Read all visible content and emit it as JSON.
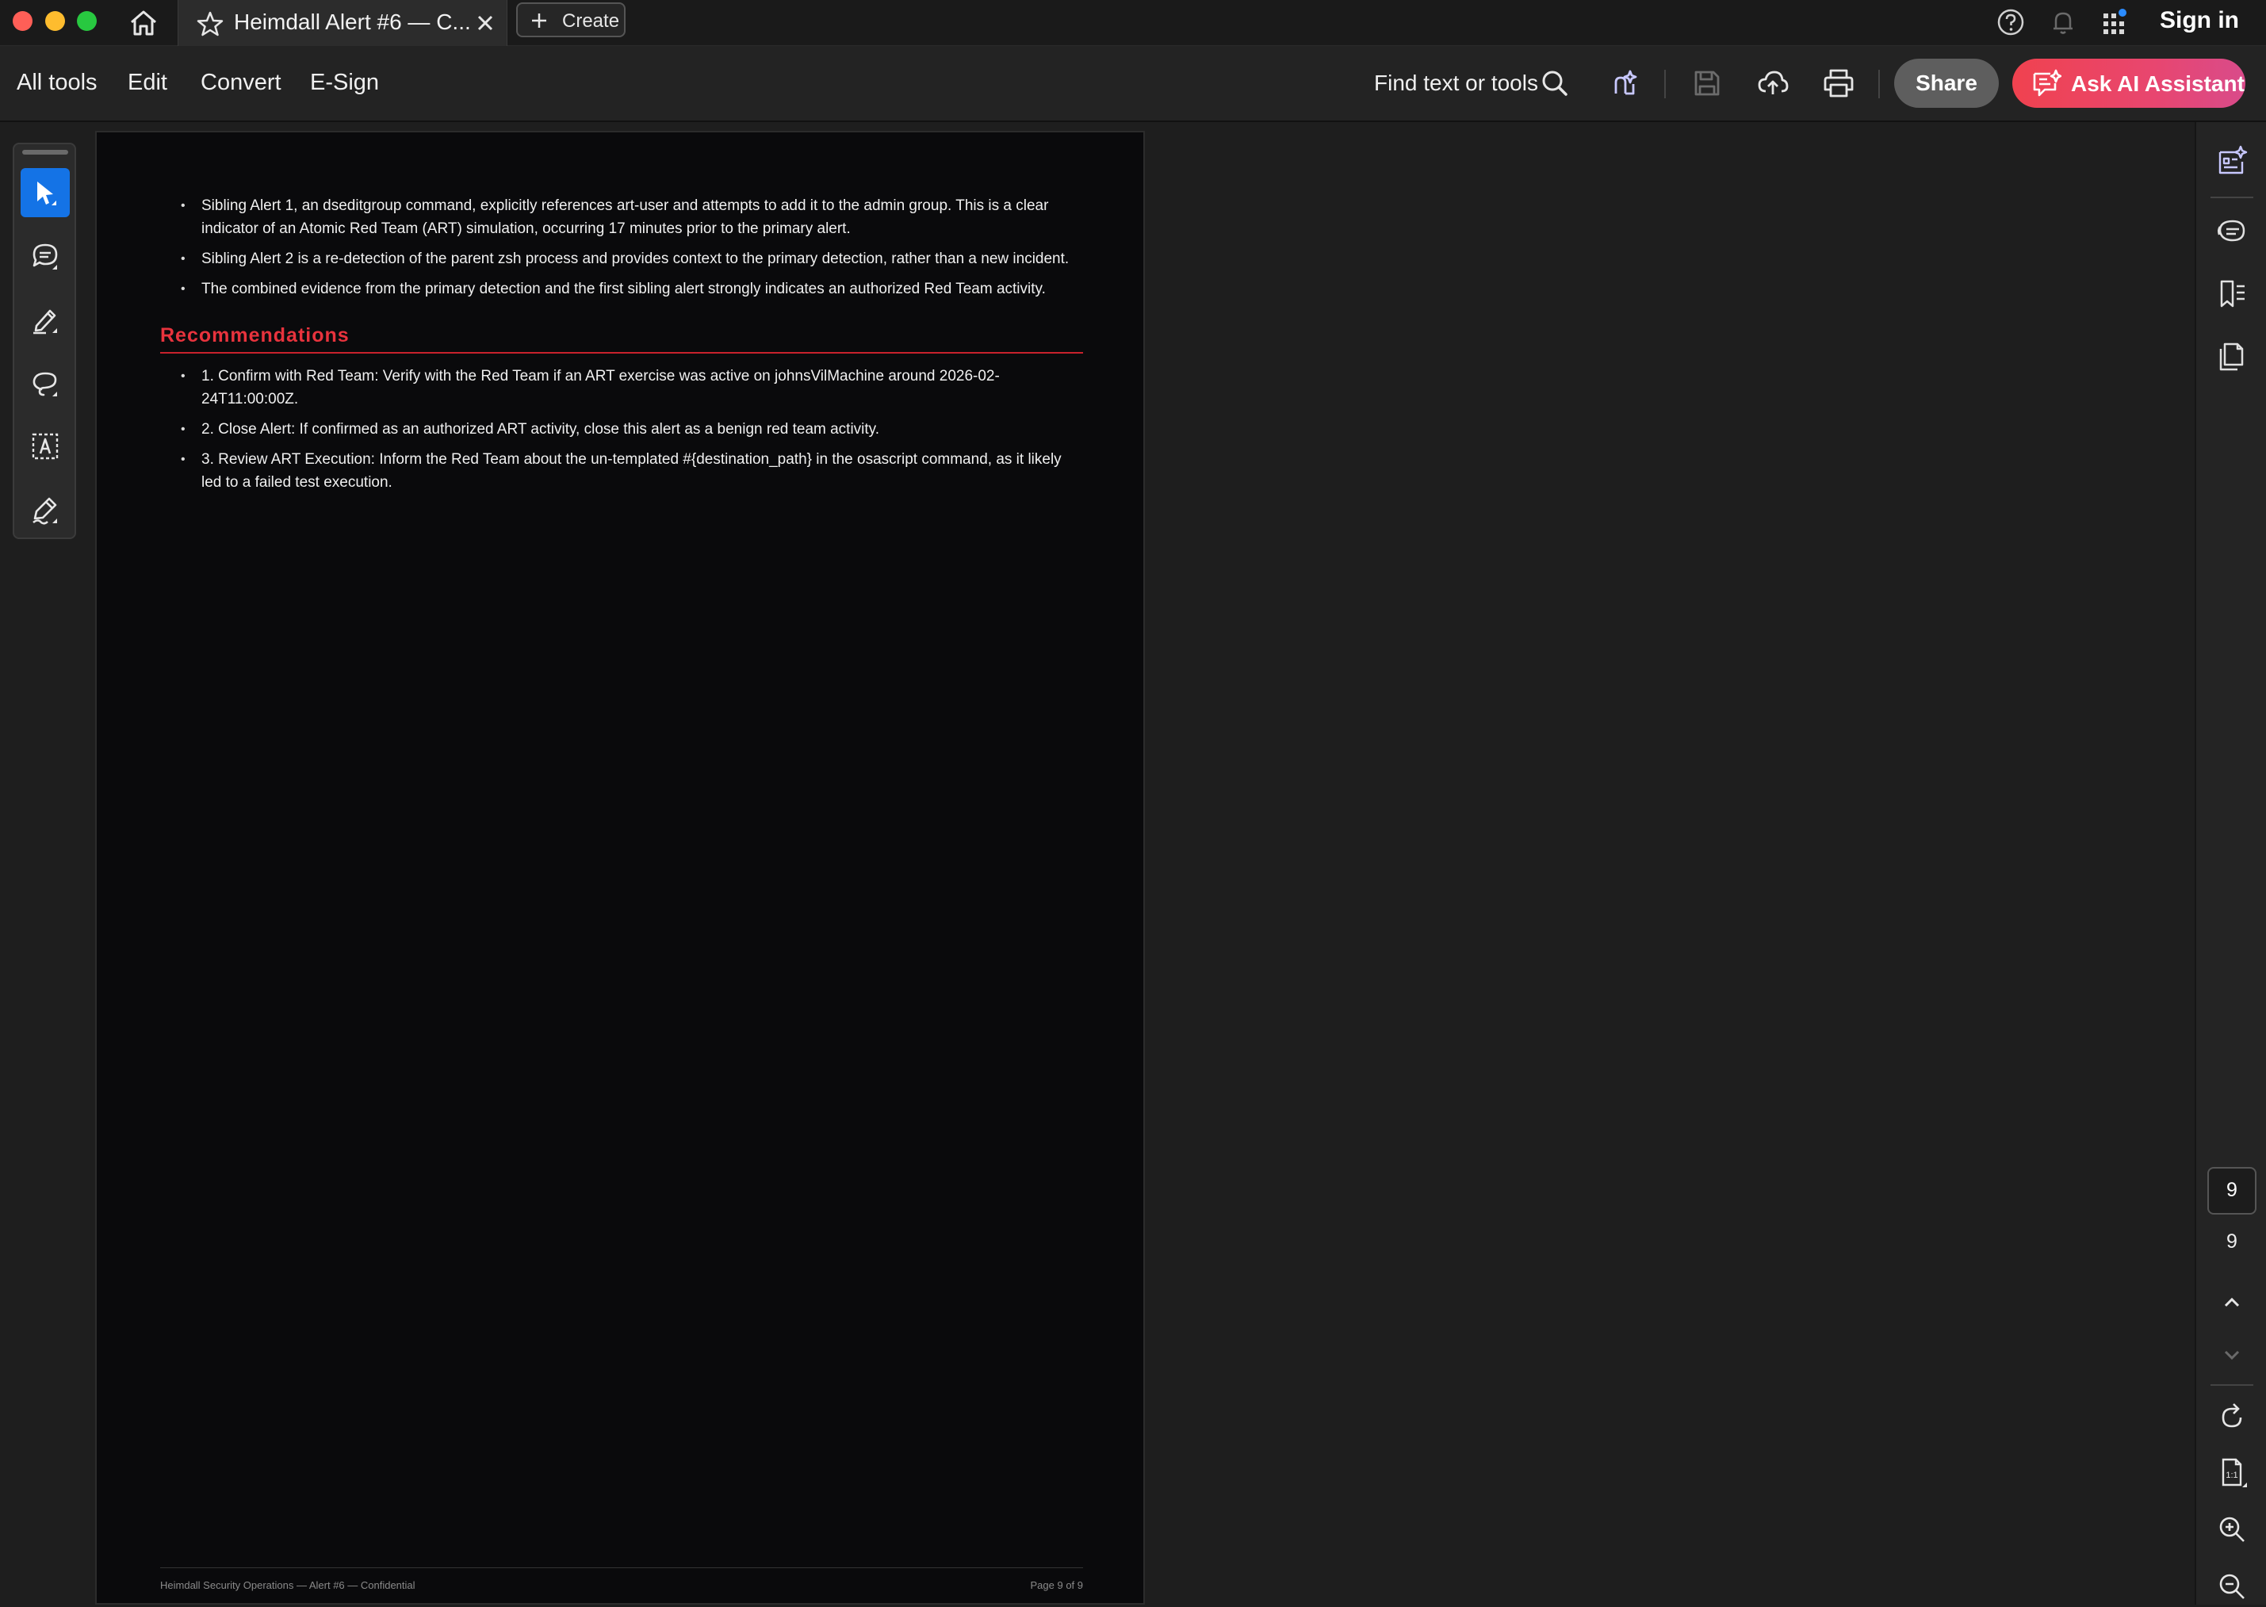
{
  "titlebar": {
    "tab_title": "Heimdall Alert #6 — C...",
    "create_label": "Create",
    "sign_in": "Sign in"
  },
  "toolbar": {
    "menu": [
      "All tools",
      "Edit",
      "Convert",
      "E-Sign"
    ],
    "find_text": "Find text or tools",
    "share": "Share",
    "ai_assistant": "Ask AI Assistant"
  },
  "palette": {
    "tools": [
      "select-tool",
      "comment-tool",
      "highlight-tool",
      "draw-tool",
      "text-select-tool",
      "sign-tool"
    ]
  },
  "document": {
    "intro_bullets": [
      "Sibling Alert 1, an dseditgroup command, explicitly references art-user and attempts to add it to the admin group. This is a clear indicator of an Atomic Red Team (ART) simulation, occurring 17 minutes prior to the primary alert.",
      "Sibling Alert 2 is a re-detection of the parent zsh process and provides context to the primary detection, rather than a new incident.",
      "The combined evidence from the primary detection and the first sibling alert strongly indicates an authorized Red Team activity."
    ],
    "recommendations_heading": "Recommendations",
    "recommendations": [
      "1.  Confirm with Red Team: Verify with the Red Team if an ART exercise was active on johnsVilMachine around 2026-02-24T11:00:00Z.",
      "2.  Close Alert: If confirmed as an authorized ART activity, close this alert as a benign red team activity.",
      "3.  Review ART Execution: Inform the Red Team about the un-templated #{destination_path} in the osascript command, as it likely led to a failed test execution."
    ],
    "footer_left": "Heimdall Security Operations — Alert #6 — Confidential",
    "footer_right": "Page 9 of 9"
  },
  "pagination": {
    "current_page": "9",
    "total_pages": "9"
  },
  "colors": {
    "accent_blue": "#1473e6",
    "ai_gradient_start": "#f0424f",
    "heading_red": "#e8333d"
  }
}
